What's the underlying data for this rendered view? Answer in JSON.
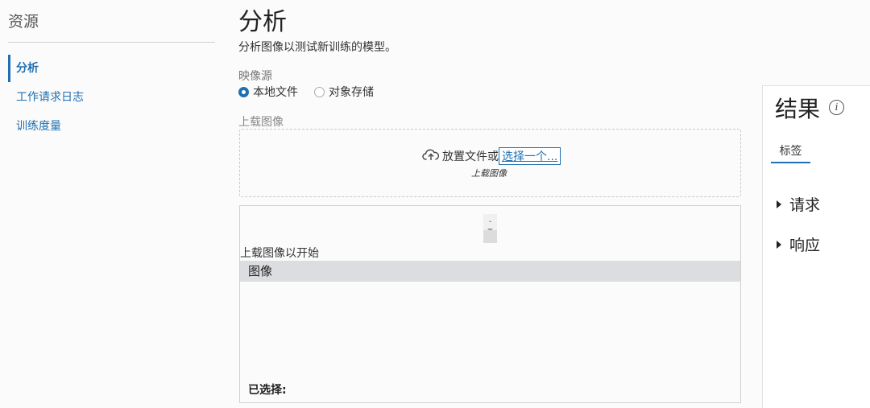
{
  "sidebar": {
    "title": "资源",
    "items": [
      {
        "label": "分析"
      },
      {
        "label": "工作请求日志"
      },
      {
        "label": "训练度量"
      }
    ]
  },
  "main": {
    "title": "分析",
    "description": "分析图像以测试新训练的模型。",
    "image_source": {
      "label": "映像源",
      "options": [
        "本地文件",
        "对象存储"
      ],
      "selected": "本地文件"
    },
    "upload": {
      "label": "上载图像",
      "drop_text": "放置文件或",
      "choose_link": "选择一个...",
      "subtext": "上载图像"
    },
    "image_panel": {
      "start_text": "上载图像以开始",
      "header": "图像",
      "selected_label": "已选择:"
    }
  },
  "results": {
    "title": "结果",
    "info_icon": "i",
    "tab": "标签",
    "sections": [
      {
        "label": "请求"
      },
      {
        "label": "响应"
      }
    ]
  },
  "colors": {
    "accent": "#1f6fb2",
    "header_band": "#dcdde0"
  },
  "icons": [
    "cloud-upload-icon",
    "info-icon",
    "caret-right-icon",
    "spinner-up-icon",
    "spinner-down-icon"
  ]
}
